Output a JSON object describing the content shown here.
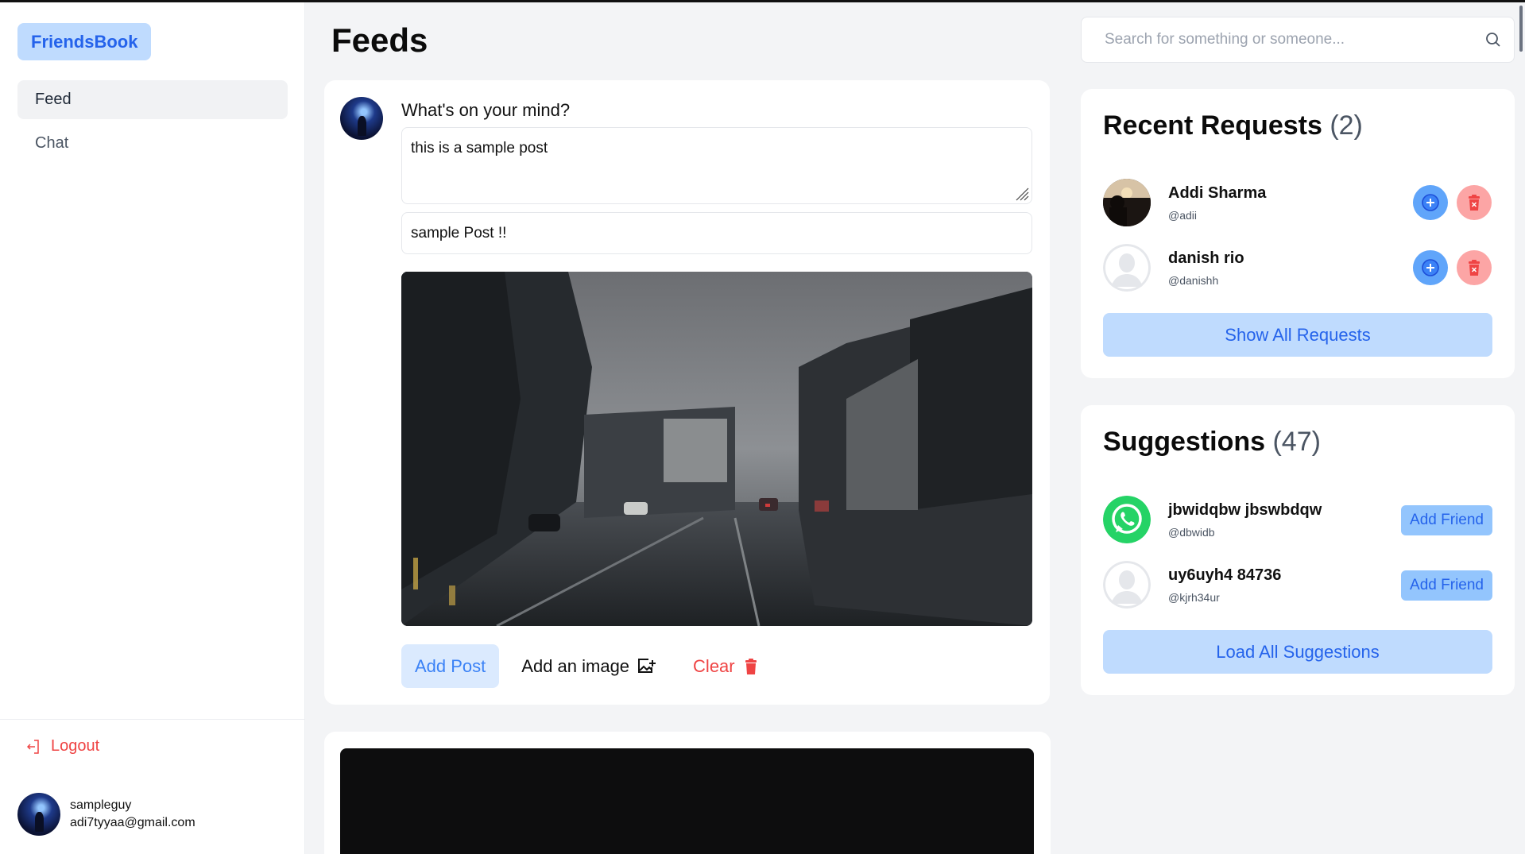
{
  "sidebar": {
    "brand": "FriendsBook",
    "nav": [
      {
        "label": "Feed",
        "active": true
      },
      {
        "label": "Chat",
        "active": false
      }
    ],
    "logout_label": "Logout",
    "user": {
      "username": "sampleguy",
      "email": "adi7tyyaa@gmail.com"
    }
  },
  "main": {
    "title": "Feeds",
    "composer": {
      "prompt": "What's on your mind?",
      "post_text": "this is a sample post",
      "post_title": "sample Post !!",
      "add_post_label": "Add Post",
      "add_image_label": "Add an image",
      "clear_label": "Clear"
    }
  },
  "search": {
    "placeholder": "Search for something or someone..."
  },
  "requests": {
    "title": "Recent Requests",
    "count": "(2)",
    "items": [
      {
        "name": "Addi Sharma",
        "handle": "@adii"
      },
      {
        "name": "danish rio",
        "handle": "@danishh"
      }
    ],
    "show_all_label": "Show All Requests"
  },
  "suggestions": {
    "title": "Suggestions",
    "count": "(47)",
    "items": [
      {
        "name": "jbwidqbw jbswbdqw",
        "handle": "@dbwidb",
        "action": "Add Friend"
      },
      {
        "name": "uy6uyh4 84736",
        "handle": "@kjrh34ur",
        "action": "Add Friend"
      }
    ],
    "load_all_label": "Load All Suggestions"
  },
  "colors": {
    "accent": "#3b82f6",
    "accent_light": "#bfdbfe",
    "danger": "#ef4444",
    "danger_light": "#fca5a5"
  }
}
